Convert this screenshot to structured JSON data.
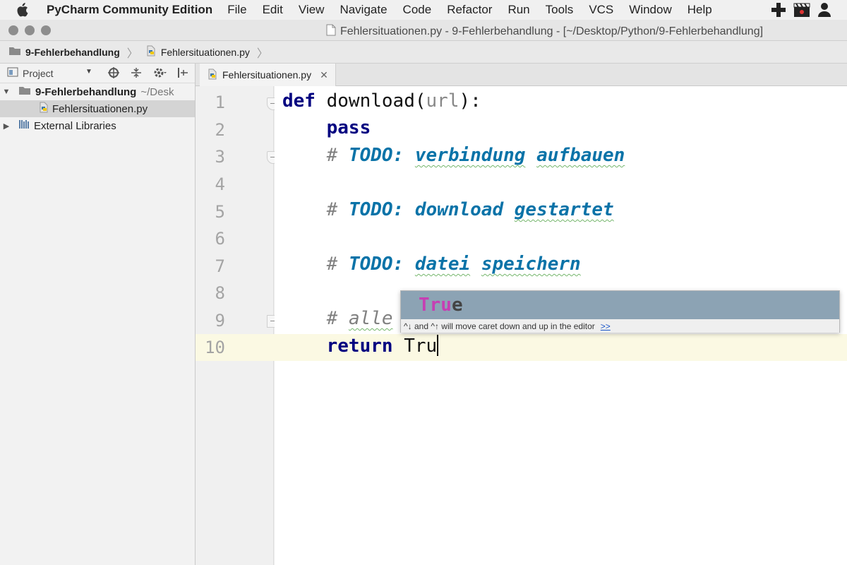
{
  "menubar": {
    "app_name": "PyCharm Community Edition",
    "items": [
      "File",
      "Edit",
      "View",
      "Navigate",
      "Code",
      "Refactor",
      "Run",
      "Tools",
      "VCS",
      "Window",
      "Help"
    ]
  },
  "window": {
    "title": "Fehlersituationen.py - 9-Fehlerbehandlung - [~/Desktop/Python/9-Fehlerbehandlung]"
  },
  "navbar": {
    "project": "9-Fehlerbehandlung",
    "file": "Fehlersituationen.py"
  },
  "project_panel": {
    "view_label": "Project",
    "root": {
      "name": "9-Fehlerbehandlung",
      "path": "~/Desk"
    },
    "file": "Fehlersituationen.py",
    "libraries": "External Libraries"
  },
  "editor": {
    "tab_label": "Fehlersituationen.py",
    "line_numbers": [
      "1",
      "2",
      "3",
      "4",
      "5",
      "6",
      "7",
      "8",
      "9",
      "10"
    ],
    "code": {
      "l1_kw": "def",
      "l1_name": " download(",
      "l1_param": "url",
      "l1_end": "):",
      "l2_kw": "pass",
      "l3_hash": "# ",
      "l3_todo": "TODO:",
      "l3_w1": "verbindung",
      "l3_w2": "aufbauen",
      "l5_hash": "# ",
      "l5_todo": "TODO:",
      "l5_w1": "download",
      "l5_w2": "gestartet",
      "l7_hash": "# ",
      "l7_todo": "TODO:",
      "l7_w1": "datei",
      "l7_w2": "speichern",
      "l9_hash": "# ",
      "l9_text": "alle",
      "l10_kw": "return",
      "l10_typed": " Tru"
    }
  },
  "completion": {
    "match": "Tru",
    "rest": "e",
    "hint": "^↓ and ^↑ will move caret down and up in the editor",
    "hint_link": ">>"
  },
  "colors": {
    "keyword": "#000080",
    "todo": "#0a73a8",
    "popup_selection": "#8ca3b4",
    "match_highlight": "#c63fb3"
  }
}
